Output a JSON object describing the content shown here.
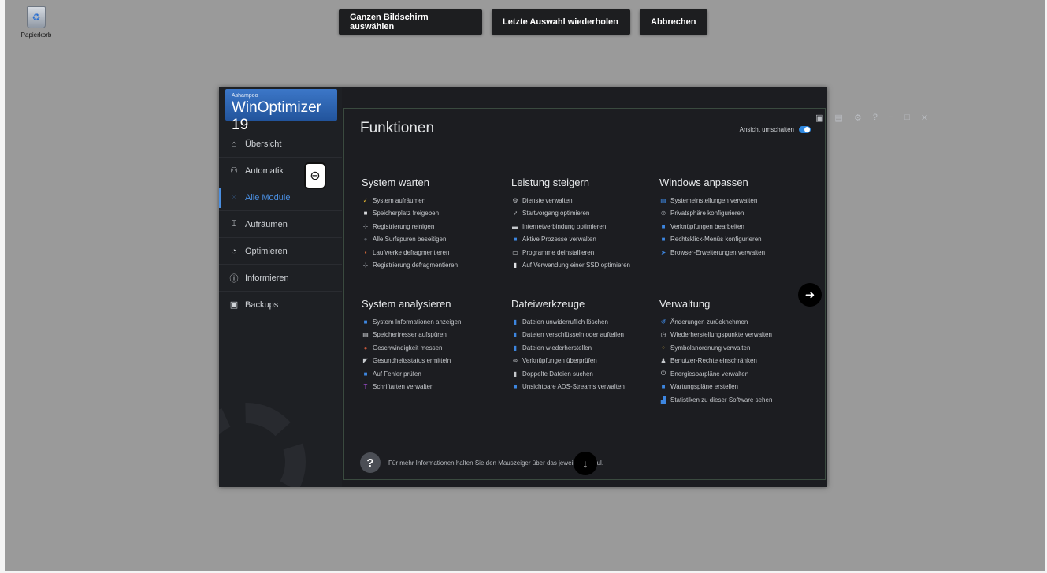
{
  "desktop": {
    "recycle_bin_label": "Papierkorb"
  },
  "capture_toolbar": {
    "select_fullscreen": "Ganzen Bildschirm auswählen",
    "repeat_last": "Letzte Auswahl wiederholen",
    "cancel": "Abbrechen"
  },
  "app": {
    "brand": "Ashampoo",
    "product": "WinOptimizer 19",
    "window_controls": [
      "chat-icon",
      "notes-icon",
      "gear-icon",
      "help-icon",
      "minimize-icon",
      "maximize-icon",
      "close-icon"
    ],
    "window_glyphs": [
      "▣",
      "▤",
      "⚙",
      "?",
      "−",
      "□",
      "✕"
    ],
    "nav": [
      {
        "label": "Übersicht",
        "icon": "home-icon",
        "glyph": "⌂",
        "active": false
      },
      {
        "label": "Automatik",
        "icon": "automation-icon",
        "glyph": "⚇",
        "active": false
      },
      {
        "label": "Alle Module",
        "icon": "grid-icon",
        "glyph": "⁙",
        "active": true
      },
      {
        "label": "Aufräumen",
        "icon": "broom-icon",
        "glyph": "⌶",
        "active": false
      },
      {
        "label": "Optimieren",
        "icon": "speedometer-icon",
        "glyph": "◔",
        "active": false
      },
      {
        "label": "Informieren",
        "icon": "info-icon",
        "glyph": "ⓘ",
        "active": false
      },
      {
        "label": "Backups",
        "icon": "camera-icon",
        "glyph": "▣",
        "active": false
      }
    ],
    "main": {
      "title": "Funktionen",
      "view_toggle_label": "Ansicht umschalten",
      "view_toggle_on": true,
      "sections": [
        {
          "title": "System warten",
          "items": [
            {
              "label": "System aufräumen",
              "icon": "broom-icon",
              "glyph": "✓",
              "color": "#e8b830"
            },
            {
              "label": "Speicherplatz freigeben",
              "icon": "disk-icon",
              "glyph": "■",
              "color": "#d6d8db"
            },
            {
              "label": "Registrierung reinigen",
              "icon": "registry-icon",
              "glyph": "⊹",
              "color": "#8f9399"
            },
            {
              "label": "Alle Surfspuren beseitigen",
              "icon": "footprints-icon",
              "glyph": "●",
              "color": "#555960"
            },
            {
              "label": "Laufwerke defragmentieren",
              "icon": "defrag-icon",
              "glyph": "▪",
              "color": "#d96a3a"
            },
            {
              "label": "Registrierung defragmentieren",
              "icon": "registry-defrag-icon",
              "glyph": "⊹",
              "color": "#8f9399"
            }
          ]
        },
        {
          "title": "Leistung steigern",
          "items": [
            {
              "label": "Dienste verwalten",
              "icon": "services-icon",
              "glyph": "⚙",
              "color": "#c5c8cc"
            },
            {
              "label": "Startvorgang optimieren",
              "icon": "rocket-icon",
              "glyph": "➶",
              "color": "#c5c8cc"
            },
            {
              "label": "Internetverbindung optimieren",
              "icon": "network-icon",
              "glyph": "▬",
              "color": "#c5c8cc"
            },
            {
              "label": "Aktive Prozesse verwalten",
              "icon": "process-icon",
              "glyph": "■",
              "color": "#3d86e0"
            },
            {
              "label": "Programme deinstallieren",
              "icon": "uninstall-icon",
              "glyph": "▭",
              "color": "#c5c8cc"
            },
            {
              "label": "Auf Verwendung einer SSD optimieren",
              "icon": "ssd-icon",
              "glyph": "▮",
              "color": "#e0e2e5"
            }
          ]
        },
        {
          "title": "Windows anpassen",
          "items": [
            {
              "label": "Systemeinstellungen verwalten",
              "icon": "settings-window-icon",
              "glyph": "▤",
              "color": "#3d86e0"
            },
            {
              "label": "Privatsphäre konfigurieren",
              "icon": "privacy-icon",
              "glyph": "⊘",
              "color": "#8f9399"
            },
            {
              "label": "Verknüpfungen bearbeiten",
              "icon": "shortcut-icon",
              "glyph": "■",
              "color": "#3d86e0"
            },
            {
              "label": "Rechtsklick-Menüs konfigurieren",
              "icon": "context-menu-icon",
              "glyph": "■",
              "color": "#3d86e0"
            },
            {
              "label": "Browser-Erweiterungen verwalten",
              "icon": "browser-extension-icon",
              "glyph": "➤",
              "color": "#3d86e0"
            }
          ]
        },
        {
          "title": "System analysieren",
          "items": [
            {
              "label": "System Informationen anzeigen",
              "icon": "system-info-icon",
              "glyph": "■",
              "color": "#3d86e0"
            },
            {
              "label": "Speicherfresser aufspüren",
              "icon": "disk-analyzer-icon",
              "glyph": "▤",
              "color": "#c5c8cc"
            },
            {
              "label": "Geschwindigkeit messen",
              "icon": "speed-icon",
              "glyph": "●",
              "color": "#c2553a"
            },
            {
              "label": "Gesundheitsstatus ermitteln",
              "icon": "health-icon",
              "glyph": "◤",
              "color": "#c5c8cc"
            },
            {
              "label": "Auf Fehler prüfen",
              "icon": "error-check-icon",
              "glyph": "■",
              "color": "#3d86e0"
            },
            {
              "label": "Schriftarten verwalten",
              "icon": "font-icon",
              "glyph": "T",
              "color": "#a64fd8"
            }
          ]
        },
        {
          "title": "Dateiwerkzeuge",
          "items": [
            {
              "label": "Dateien unwiderruflich löschen",
              "icon": "shred-icon",
              "glyph": "▮",
              "color": "#3d86e0"
            },
            {
              "label": "Dateien verschlüsseln oder aufteilen",
              "icon": "encrypt-icon",
              "glyph": "▮",
              "color": "#3d86e0"
            },
            {
              "label": "Dateien wiederherstellen",
              "icon": "undelete-icon",
              "glyph": "▮",
              "color": "#3d86e0"
            },
            {
              "label": "Verknüpfungen überprüfen",
              "icon": "link-icon",
              "glyph": "∞",
              "color": "#c5c8cc"
            },
            {
              "label": "Doppelte Dateien suchen",
              "icon": "duplicate-icon",
              "glyph": "▮",
              "color": "#c5c8cc"
            },
            {
              "label": "Unsichtbare ADS-Streams verwalten",
              "icon": "ads-icon",
              "glyph": "■",
              "color": "#3d86e0"
            }
          ]
        },
        {
          "title": "Verwaltung",
          "items": [
            {
              "label": "Änderungen zurücknehmen",
              "icon": "undo-icon",
              "glyph": "↺",
              "color": "#3d86e0"
            },
            {
              "label": "Wiederherstellungspunkte verwalten",
              "icon": "restore-point-icon",
              "glyph": "◷",
              "color": "#c5c8cc"
            },
            {
              "label": "Symbolanordnung verwalten",
              "icon": "icon-layout-icon",
              "glyph": "⁘",
              "color": "#c7a640"
            },
            {
              "label": "Benutzer-Rechte einschränken",
              "icon": "user-rights-icon",
              "glyph": "♟",
              "color": "#c5c8cc"
            },
            {
              "label": "Energiesparpläne verwalten",
              "icon": "power-icon",
              "glyph": "⏻",
              "color": "#c5c8cc"
            },
            {
              "label": "Wartungspläne erstellen",
              "icon": "calendar-icon",
              "glyph": "■",
              "color": "#3d86e0"
            },
            {
              "label": "Statistiken zu dieser Software sehen",
              "icon": "stats-icon",
              "glyph": "▟",
              "color": "#3d86e0"
            }
          ]
        }
      ],
      "footer_text": "Für mehr Informationen halten Sie den Mauszeiger über das jeweilige Modul."
    }
  }
}
